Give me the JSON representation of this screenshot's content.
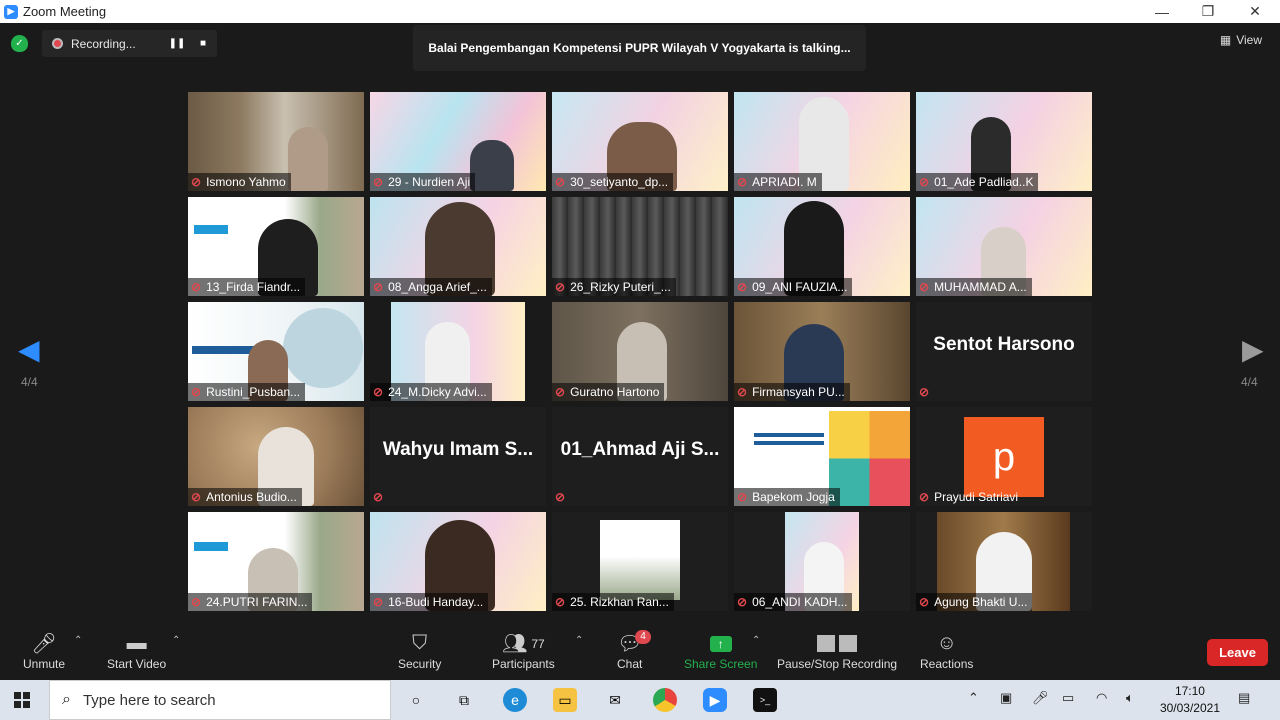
{
  "window": {
    "title": "Zoom Meeting",
    "minimize": "—",
    "maximize": "❐",
    "close": "✕"
  },
  "topbar": {
    "recording_label": "Recording...",
    "talking": "Balai Pengembangan Kompetensi PUPR Wilayah V Yogyakarta is talking...",
    "view_label": "View"
  },
  "pager": {
    "left": "4/4",
    "right": "4/4"
  },
  "tiles": [
    "Ismono Yahmo",
    "29 - Nurdien Aji",
    "30_setiyanto_dp...",
    "APRIADI. M",
    "01_Ade Padliad..K",
    "13_Firda Fiandr...",
    "08_Angga Arief_...",
    "26_Rizky Puteri_...",
    "09_ANI FAUZIA...",
    "MUHAMMAD A...",
    "Rustini_Pusban...",
    "24_M.Dicky Advi...",
    "Guratno Hartono",
    "Firmansyah PU...",
    "",
    "Antonius Budio...",
    "",
    "",
    "Bapekom Jogja",
    "Prayudi Satriavi",
    "24.PUTRI FARIN...",
    "16-Budi Handay...",
    "25. Rizkhan Ran...",
    "06_ANDI KADH...",
    "Agung Bhakti U..."
  ],
  "name_tiles": {
    "sentot": "Sentot Harsono",
    "wahyu": "Wahyu Imam S...",
    "ahmad": "01_Ahmad Aji S..."
  },
  "avatar_letter": "p",
  "toolbar": {
    "unmute": "Unmute",
    "start_video": "Start Video",
    "security": "Security",
    "participants": "Participants",
    "participants_count": "77",
    "chat": "Chat",
    "chat_badge": "4",
    "share": "Share Screen",
    "record": "Pause/Stop Recording",
    "reactions": "Reactions",
    "leave": "Leave"
  },
  "taskbar": {
    "search_placeholder": "Type here to search",
    "time": "17:10",
    "date": "30/03/2021"
  },
  "colors": {
    "zoom_blue": "#2d8cff",
    "leave_red": "#d92626",
    "share_green": "#23b14d",
    "mute_red": "#e0484f"
  }
}
